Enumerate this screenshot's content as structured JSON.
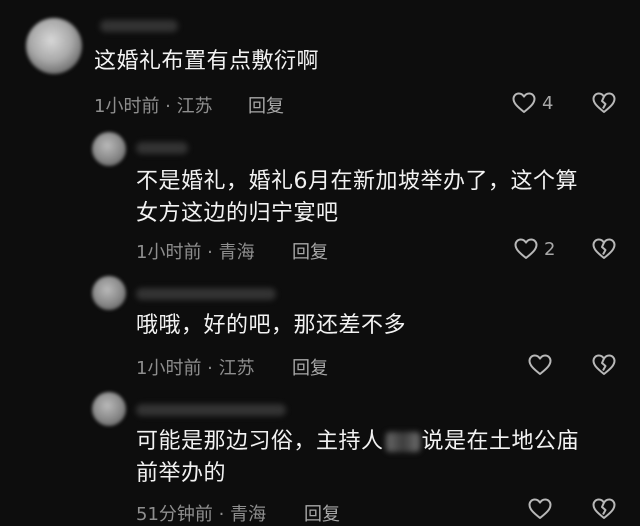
{
  "comments": [
    {
      "text": "这婚礼布置有点敷衍啊",
      "meta": "1小时前 · 江苏",
      "reply_label": "回复",
      "likes": "4"
    },
    {
      "text_line1": "不是婚礼，婚礼6月在新加坡举办了，这个算",
      "text_line2": "女方这边的归宁宴吧",
      "meta": "1小时前 · 青海",
      "reply_label": "回复",
      "likes": "2"
    },
    {
      "text": "哦哦，好的吧，那还差不多",
      "meta": "1小时前 · 江苏",
      "reply_label": "回复",
      "likes": ""
    },
    {
      "text_line1_a": "可能是那边习俗，主持人",
      "text_line1_b": "说是在土地公庙",
      "text_line2": "前举办的",
      "meta": "51分钟前 · 青海",
      "reply_label": "回复",
      "likes": ""
    }
  ],
  "colors": {
    "background": "#0d0d0d",
    "text": "#f2f2f2",
    "meta": "#8e8e8e"
  },
  "icons": [
    "heart-outline-icon",
    "broken-heart-icon"
  ]
}
